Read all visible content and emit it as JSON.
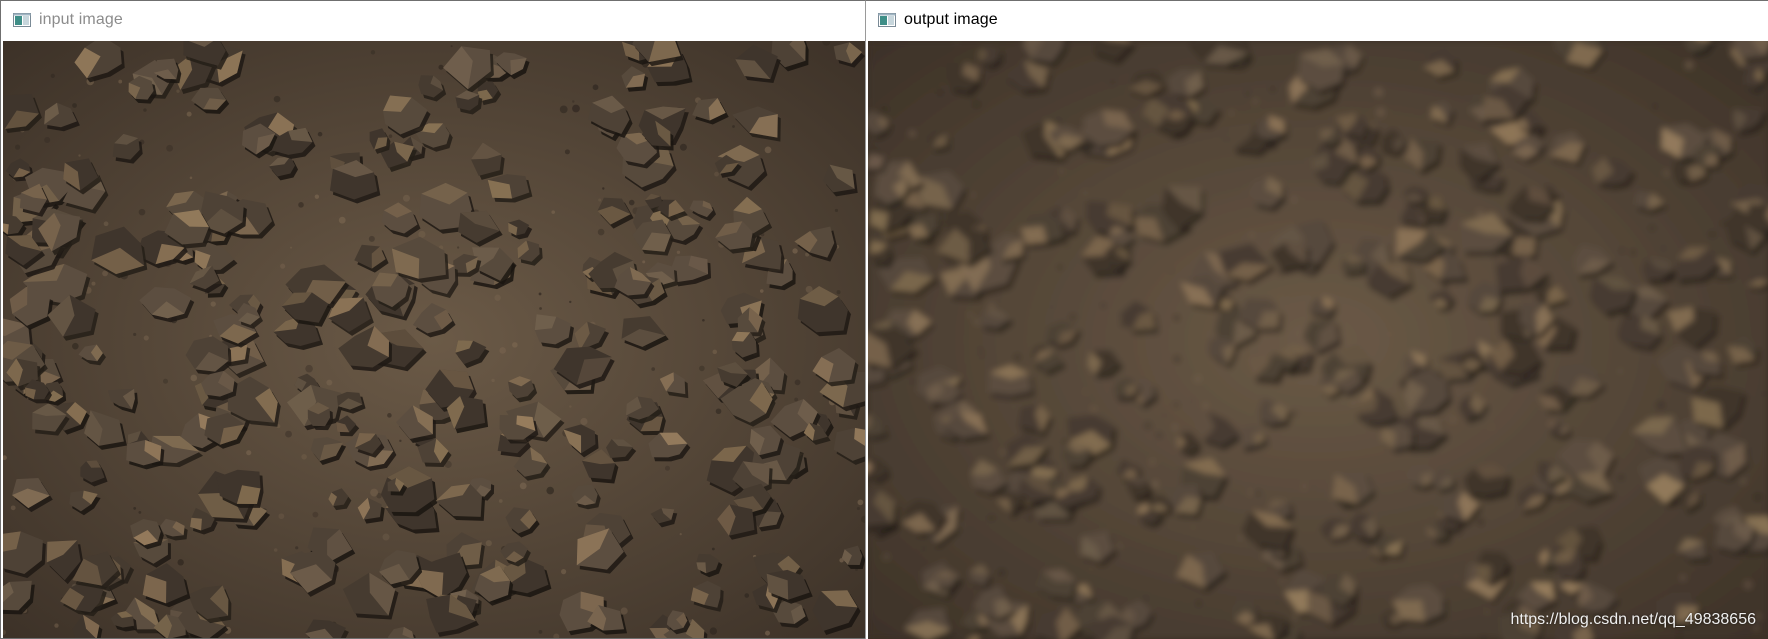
{
  "windows": {
    "input": {
      "title": "input image",
      "icon": "opencv-window-icon",
      "active": false
    },
    "output": {
      "title": "output image",
      "icon": "opencv-window-icon",
      "active": true
    }
  },
  "watermark": "https://blog.csdn.net/qq_49838656",
  "colors": {
    "title_inactive": "#8c8c8c",
    "title_active": "#000000",
    "window_border": "#6f6f6f",
    "gravel_ground": "#5a4b3c",
    "gravel_stone": "#4a3e33",
    "gravel_highlight": "#a08560"
  }
}
